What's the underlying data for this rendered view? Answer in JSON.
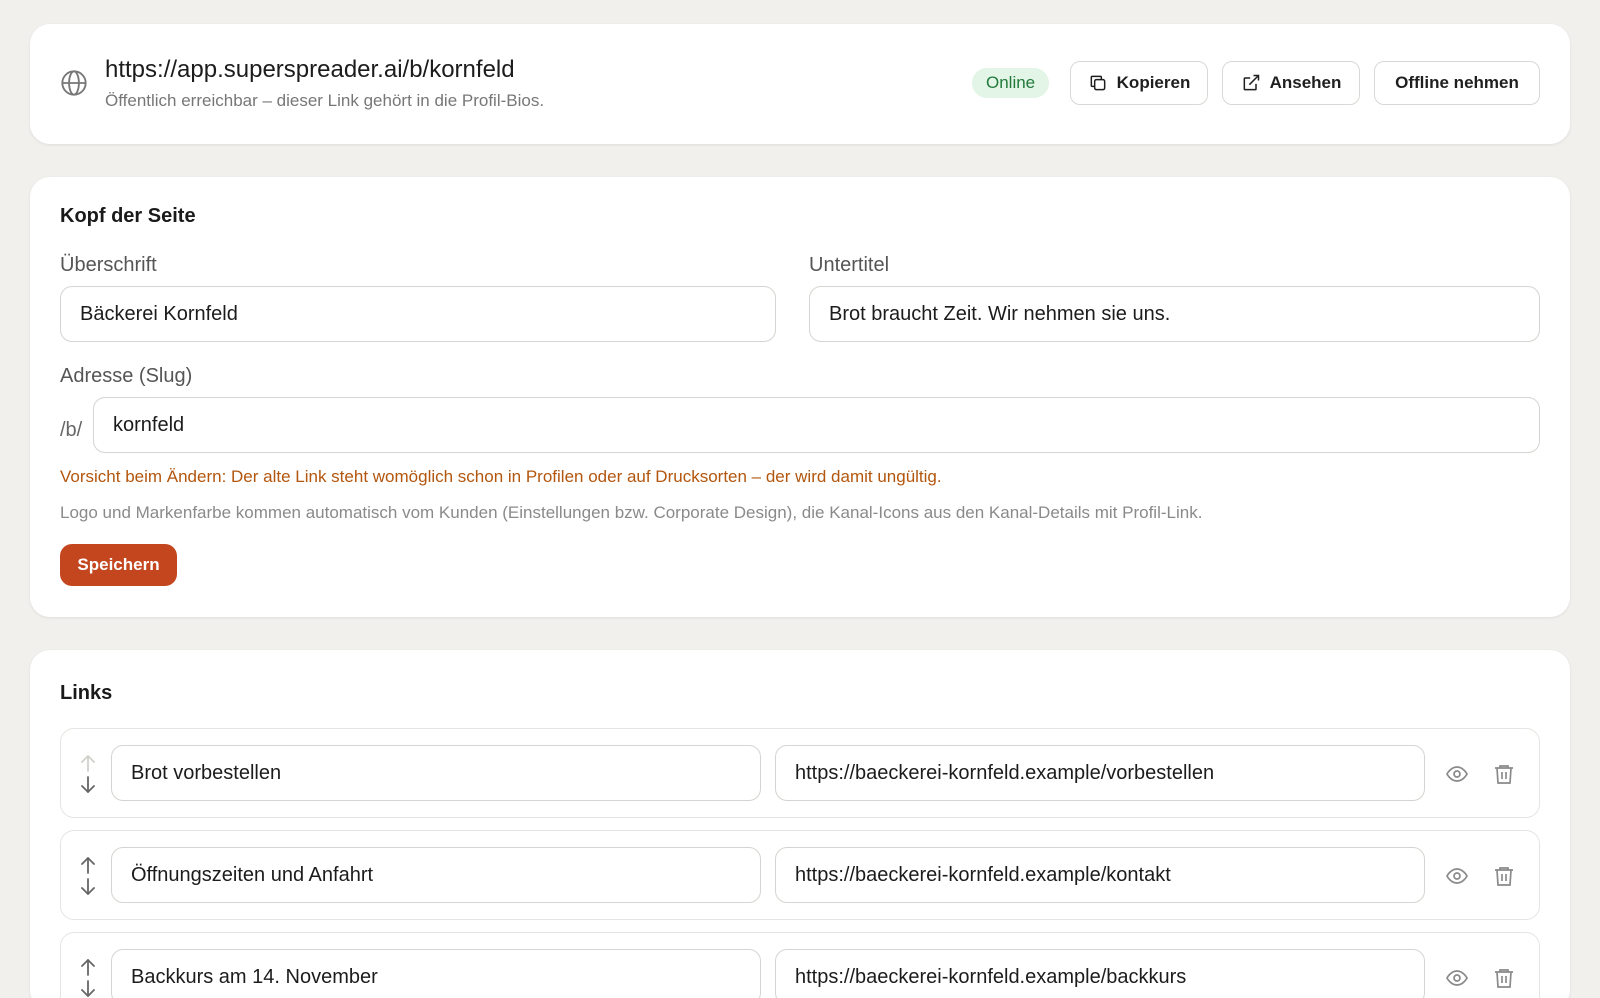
{
  "publish": {
    "url": "https://app.superspreader.ai/b/kornfeld",
    "subtitle": "Öffentlich erreichbar – dieser Link gehört in die Profil-Bios.",
    "status": "Online",
    "copy_label": "Kopieren",
    "view_label": "Ansehen",
    "offline_label": "Offline nehmen"
  },
  "head": {
    "section_title": "Kopf der Seite",
    "heading_label": "Überschrift",
    "heading_value": "Bäckerei Kornfeld",
    "subtitle_label": "Untertitel",
    "subtitle_value": "Brot braucht Zeit. Wir nehmen sie uns.",
    "slug_label": "Adresse (Slug)",
    "slug_prefix": "/b/",
    "slug_value": "kornfeld",
    "warning": "Vorsicht beim Ändern: Der alte Link steht womöglich schon in Profilen oder auf Drucksorten – der wird damit ungültig.",
    "hint": "Logo und Markenfarbe kommen automatisch vom Kunden (Einstellungen bzw. Corporate Design), die Kanal-Icons aus den Kanal-Details mit Profil-Link.",
    "save_label": "Speichern"
  },
  "links": {
    "section_title": "Links",
    "items": [
      {
        "title": "Brot vorbestellen",
        "url": "https://baeckerei-kornfeld.example/vorbestellen"
      },
      {
        "title": "Öffnungszeiten und Anfahrt",
        "url": "https://baeckerei-kornfeld.example/kontakt"
      },
      {
        "title": "Backkurs am 14. November",
        "url": "https://baeckerei-kornfeld.example/backkurs"
      }
    ]
  },
  "colors": {
    "accent": "#c4461f",
    "online_bg": "#e2f5e6",
    "online_text": "#217a3c",
    "warning": "#b3560e"
  },
  "icons": [
    "globe-icon",
    "copy-icon",
    "external-link-icon",
    "arrow-up-icon",
    "arrow-down-icon",
    "eye-icon",
    "trash-icon"
  ]
}
